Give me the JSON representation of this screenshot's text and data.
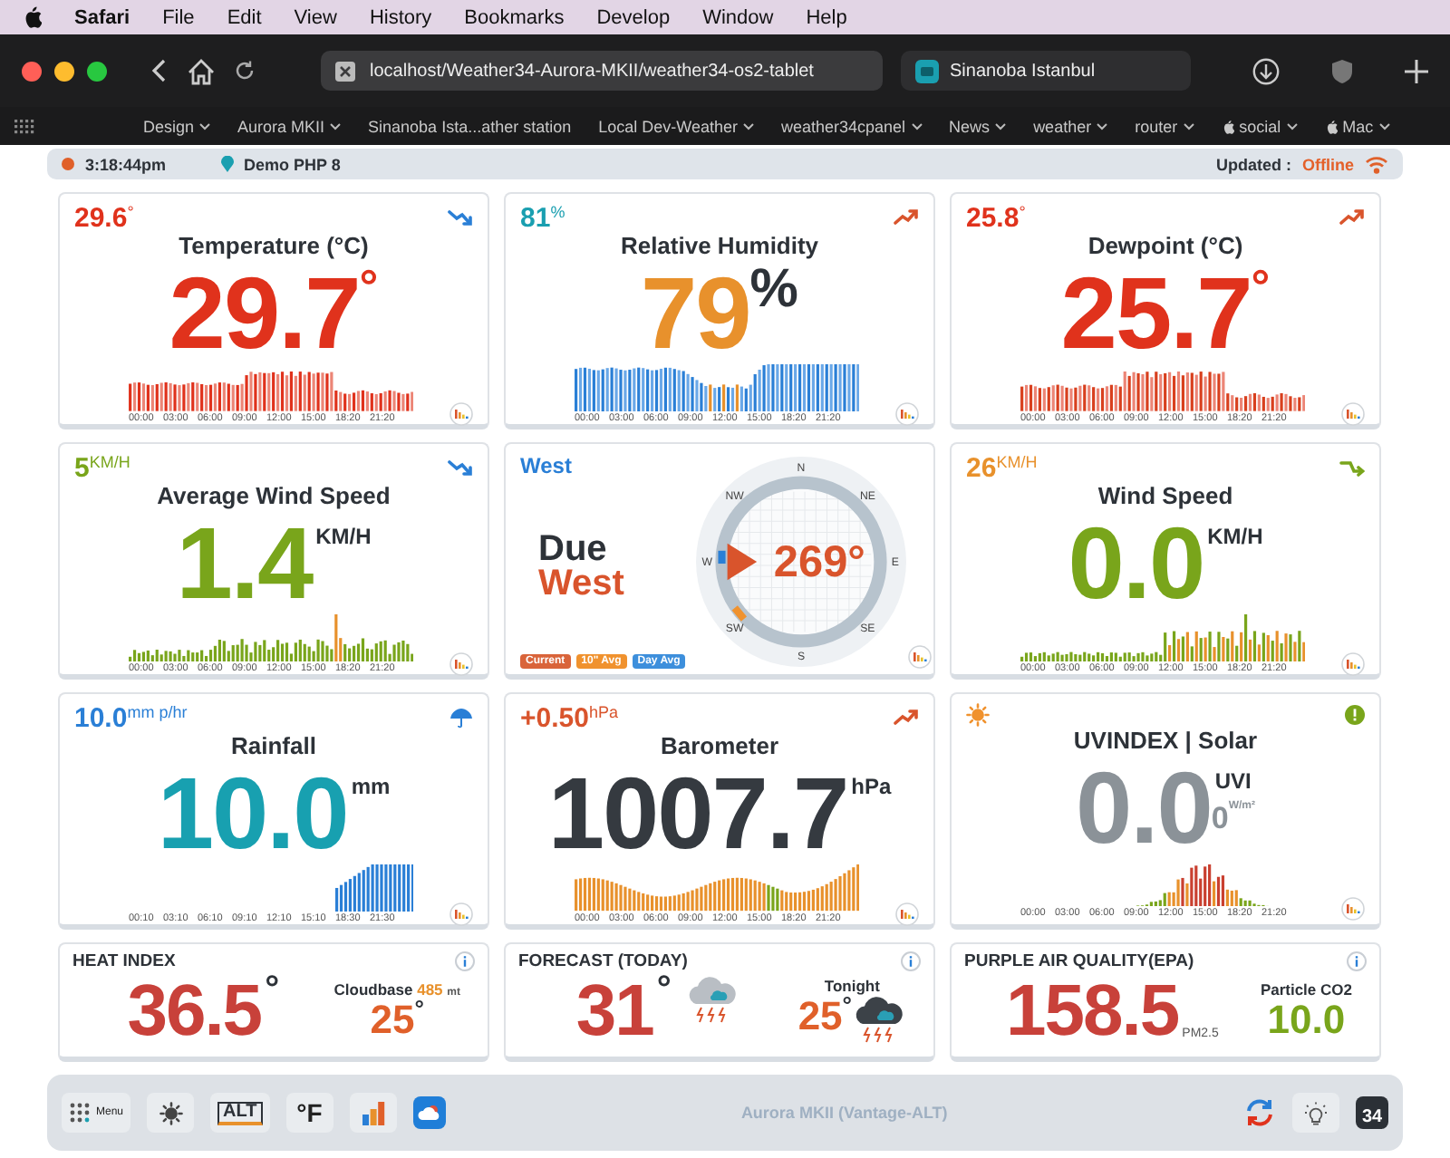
{
  "menubar": {
    "app": "Safari",
    "menus": [
      "File",
      "Edit",
      "View",
      "History",
      "Bookmarks",
      "Develop",
      "Window",
      "Help"
    ]
  },
  "browser": {
    "url": "localhost/Weather34-Aurora-MKII/weather34-os2-tablet",
    "tab": "Sinanoba Istanbul",
    "bookmarks": [
      {
        "label": "Design",
        "kind": "folder"
      },
      {
        "label": "Aurora MKII",
        "kind": "folder"
      },
      {
        "label": "Sinanoba Ista...ather station",
        "kind": "link"
      },
      {
        "label": "Local Dev-Weather",
        "kind": "folder"
      },
      {
        "label": "weather34cpanel",
        "kind": "folder"
      },
      {
        "label": "News",
        "kind": "folder"
      },
      {
        "label": "weather",
        "kind": "folder"
      },
      {
        "label": "router",
        "kind": "folder"
      },
      {
        "label": "social",
        "kind": "apple_folder"
      },
      {
        "label": "Mac",
        "kind": "apple_folder"
      }
    ]
  },
  "status": {
    "time": "3:18:44pm",
    "location": "Demo PHP 8",
    "updated_label": "Updated :",
    "updated_value": "Offline"
  },
  "cards": [
    {
      "kind": "temperature",
      "small": "29.6",
      "small_unit": "°",
      "corner": {
        "kind": "falling"
      },
      "title": "Temperature (°C)",
      "value": "29.7",
      "unit": "°",
      "x_labels": [
        "00:00",
        "03:00",
        "06:00",
        "09:00",
        "12:00",
        "15:00",
        "18:20",
        "21:20"
      ]
    },
    {
      "kind": "humidity",
      "small": "81",
      "small_unit": "%",
      "corner": {
        "kind": "rising"
      },
      "title": "Relative Humidity",
      "value": "79",
      "unit": "%",
      "x_labels": [
        "00:00",
        "03:00",
        "06:00",
        "09:00",
        "12:00",
        "15:00",
        "18:20",
        "21:20"
      ]
    },
    {
      "kind": "dewpoint",
      "small": "25.8",
      "small_unit": "°",
      "corner": {
        "kind": "rising"
      },
      "title": "Dewpoint (°C)",
      "value": "25.7",
      "unit": "°",
      "x_labels": [
        "00:00",
        "03:00",
        "06:00",
        "09:00",
        "12:00",
        "15:00",
        "18:20",
        "21:20"
      ]
    },
    {
      "kind": "wind_avg",
      "small": "5",
      "small_unit": "KM/H",
      "corner": {
        "kind": "falling"
      },
      "title": "Average Wind Speed",
      "value": "1.4",
      "unit": "KM/H",
      "x_labels": [
        "00:00",
        "03:00",
        "06:00",
        "09:00",
        "12:00",
        "15:00",
        "18:20",
        "21:20"
      ]
    },
    {
      "kind": "compass",
      "heading": "West",
      "dir_top": "Due",
      "dir_bottom": "West",
      "degrees": "269°",
      "points": [
        "N",
        "NE",
        "E",
        "SE",
        "S",
        "SW",
        "W",
        "NW"
      ],
      "legend": [
        {
          "label": "Current",
          "color": "#d9643a"
        },
        {
          "label": "10\" Avg",
          "color": "#f0922e"
        },
        {
          "label": "Day Avg",
          "color": "#3d8fdc"
        }
      ]
    },
    {
      "kind": "wind",
      "small": "26",
      "small_unit": "KM/H",
      "corner": {
        "kind": "steady"
      },
      "title": "Wind Speed",
      "value": "0.0",
      "unit": "KM/H",
      "x_labels": [
        "00:00",
        "03:00",
        "06:00",
        "09:00",
        "12:00",
        "15:00",
        "18:20",
        "21:20"
      ]
    },
    {
      "kind": "rain",
      "small": "10.0",
      "small_unit": "mm p/hr",
      "corner": {
        "kind": "umbrella"
      },
      "title": "Rainfall",
      "value": "10.0",
      "unit": "mm",
      "x_labels": [
        "00:10",
        "03:10",
        "06:10",
        "09:10",
        "12:10",
        "15:10",
        "18:30",
        "21:30"
      ]
    },
    {
      "kind": "pressure",
      "small": "+0.50",
      "small_unit": "hPa",
      "corner": {
        "kind": "rising"
      },
      "title": "Barometer",
      "value": "1007.7",
      "unit": "hPa",
      "x_labels": [
        "00:00",
        "03:00",
        "06:00",
        "09:00",
        "12:00",
        "15:00",
        "18:20",
        "21:20"
      ]
    },
    {
      "kind": "uv",
      "lead": {
        "kind": "sun"
      },
      "corner": {
        "kind": "alert"
      },
      "title": "UVINDEX | Solar",
      "value": "0.0",
      "unit": "UVI",
      "extra": "0",
      "extra_unit": "W/m²",
      "x_labels": [
        "00:00",
        "03:00",
        "06:00",
        "09:00",
        "12:00",
        "15:00",
        "18:20",
        "21:20"
      ]
    }
  ],
  "mini_cards": [
    {
      "kind": "heat",
      "title": "HEAT INDEX",
      "value": "36.5",
      "unit": "°",
      "side_label": "Cloudbase",
      "side_value": "485",
      "side_unit": "mt",
      "side_big": "25",
      "side_big_unit": "°"
    },
    {
      "kind": "forecast",
      "title": "FORECAST (TODAY)",
      "value": "31",
      "unit": "°",
      "side_label": "Tonight",
      "side_big": "25",
      "side_big_unit": "°"
    },
    {
      "kind": "air",
      "title": "PURPLE AIR QUALITY(EPA)",
      "value": "158.5",
      "unit": "PM2.5",
      "side_label": "Particle CO2",
      "side_big": "10.0"
    }
  ],
  "dock": {
    "left": [
      {
        "kind": "menu",
        "label": "Menu"
      },
      {
        "kind": "brightness"
      },
      {
        "kind": "alt",
        "label": "ALT"
      },
      {
        "kind": "units",
        "label": "°F"
      },
      {
        "kind": "charts"
      },
      {
        "kind": "app"
      }
    ],
    "center": "Aurora MKII (Vantage-ALT)",
    "right": [
      {
        "kind": "refresh"
      },
      {
        "kind": "bulb"
      },
      {
        "kind": "logo",
        "label": "34"
      }
    ]
  }
}
